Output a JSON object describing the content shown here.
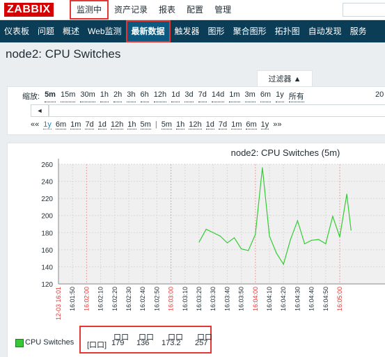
{
  "app": {
    "logo": "ZABBIX"
  },
  "top_menu": {
    "items": [
      {
        "label": "监测中",
        "active": true
      },
      {
        "label": "资产记录"
      },
      {
        "label": "报表"
      },
      {
        "label": "配置"
      },
      {
        "label": "管理"
      }
    ]
  },
  "sub_menu": {
    "items": [
      {
        "label": "仪表板"
      },
      {
        "label": "问题"
      },
      {
        "label": "概述"
      },
      {
        "label": "Web监测"
      },
      {
        "label": "最新数据",
        "active": true
      },
      {
        "label": "触发器"
      },
      {
        "label": "图形"
      },
      {
        "label": "聚合图形"
      },
      {
        "label": "拓扑图"
      },
      {
        "label": "自动发现"
      },
      {
        "label": "服务"
      }
    ]
  },
  "page": {
    "title": "node2: CPU Switches"
  },
  "filter": {
    "tab_label": "过滤器 ▲",
    "zoom_label": "缩放:",
    "zoom_options": [
      "5m",
      "15m",
      "30m",
      "1h",
      "2h",
      "3h",
      "6h",
      "12h",
      "1d",
      "3d",
      "7d",
      "14d",
      "1m",
      "3m",
      "6m",
      "1y",
      "所有"
    ],
    "zoom_right_text": "20",
    "prev_button": "◄",
    "period_prefix": "««",
    "period_left": [
      "1y",
      "6m",
      "1m",
      "7d",
      "1d",
      "12h",
      "1h",
      "5m"
    ],
    "period_sep": "|",
    "period_right": [
      "5m",
      "1h",
      "12h",
      "1d",
      "7d",
      "1m",
      "6m",
      "1y"
    ],
    "period_suffix": "»»"
  },
  "graph": {
    "title": "node2: CPU Switches (5m)",
    "colors": {
      "series": "#33cc33",
      "red_tick": "#e33734",
      "grid": "#d8d8d8",
      "plot_bg": "#f0f0f0"
    }
  },
  "chart_data": {
    "type": "line",
    "title": "node2: CPU Switches (5m)",
    "ylim": [
      120,
      260
    ],
    "yticks": [
      120,
      140,
      160,
      180,
      200,
      220,
      240,
      260
    ],
    "xtick_labels": [
      {
        "text": "12-03 16:01",
        "red": true
      },
      {
        "text": "16:01:50",
        "red": false
      },
      {
        "text": "16:02:00",
        "red": true
      },
      {
        "text": "16:02:10",
        "red": false
      },
      {
        "text": "16:02:20",
        "red": false
      },
      {
        "text": "16:02:30",
        "red": false
      },
      {
        "text": "16:02:40",
        "red": false
      },
      {
        "text": "16:02:50",
        "red": false
      },
      {
        "text": "16:03:00",
        "red": true
      },
      {
        "text": "16:03:10",
        "red": false
      },
      {
        "text": "16:03:20",
        "red": false
      },
      {
        "text": "16:03:30",
        "red": false
      },
      {
        "text": "16:03:40",
        "red": false
      },
      {
        "text": "16:03:50",
        "red": false
      },
      {
        "text": "16:04:00",
        "red": true
      },
      {
        "text": "16:04:10",
        "red": false
      },
      {
        "text": "16:04:20",
        "red": false
      },
      {
        "text": "16:04:30",
        "red": false
      },
      {
        "text": "16:04:40",
        "red": false
      },
      {
        "text": "16:04:50",
        "red": false
      },
      {
        "text": "16:05:00",
        "red": true
      }
    ],
    "series": [
      {
        "name": "CPU Switches",
        "points": [
          {
            "t": "16:03:20",
            "y": 169
          },
          {
            "t": "16:03:25",
            "y": 184
          },
          {
            "t": "16:03:35",
            "y": 176
          },
          {
            "t": "16:03:40",
            "y": 168
          },
          {
            "t": "16:03:45",
            "y": 174
          },
          {
            "t": "16:03:50",
            "y": 161
          },
          {
            "t": "16:03:55",
            "y": 159
          },
          {
            "t": "16:04:00",
            "y": 178
          },
          {
            "t": "16:04:05",
            "y": 256
          },
          {
            "t": "16:04:10",
            "y": 176
          },
          {
            "t": "16:04:15",
            "y": 156
          },
          {
            "t": "16:04:20",
            "y": 143
          },
          {
            "t": "16:04:25",
            "y": 172
          },
          {
            "t": "16:04:30",
            "y": 194
          },
          {
            "t": "16:04:35",
            "y": 167
          },
          {
            "t": "16:04:40",
            "y": 171
          },
          {
            "t": "16:04:45",
            "y": 172
          },
          {
            "t": "16:04:50",
            "y": 167
          },
          {
            "t": "16:04:55",
            "y": 199
          },
          {
            "t": "16:05:00",
            "y": 175
          },
          {
            "t": "16:05:05",
            "y": 225
          },
          {
            "t": "16:05:08",
            "y": 183
          }
        ]
      }
    ]
  },
  "legend": {
    "name": "CPU Switches",
    "bracket_label": "[口口]",
    "headers": [
      "口口",
      "口口",
      "口口",
      "口口"
    ],
    "values": [
      "179",
      "136",
      "173.2",
      "257"
    ]
  }
}
